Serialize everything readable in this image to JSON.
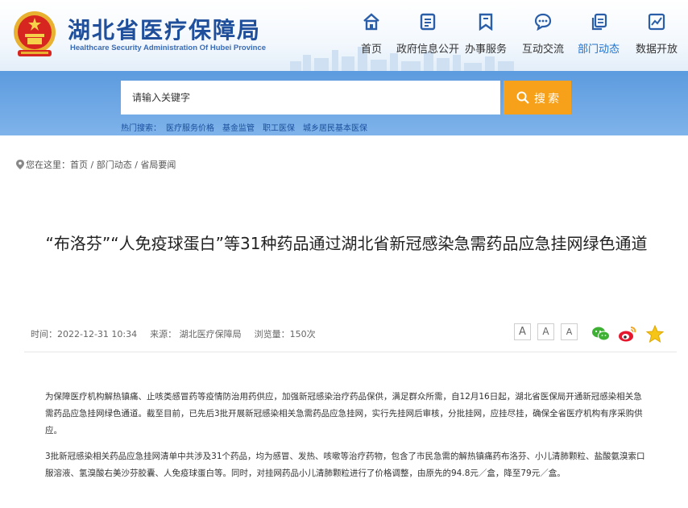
{
  "header": {
    "title": "湖北省医疗保障局",
    "subtitle": "Healthcare Security Administration Of Hubei Province"
  },
  "nav": [
    {
      "label": "首页",
      "icon": "home-icon"
    },
    {
      "label": "政府信息公开",
      "icon": "document-icon"
    },
    {
      "label": "办事服务",
      "icon": "bookmark-icon"
    },
    {
      "label": "互动交流",
      "icon": "chat-icon"
    },
    {
      "label": "部门动态",
      "icon": "copy-icon",
      "active": true
    },
    {
      "label": "数据开放",
      "icon": "chart-icon"
    }
  ],
  "search": {
    "placeholder": "请输入关键字",
    "button_label": "搜索",
    "hot_label": "热门搜索：",
    "hot_items": [
      "医疗服务价格",
      "基金监管",
      "职工医保",
      "城乡居民基本医保"
    ]
  },
  "breadcrumb": {
    "prefix": "您在这里：",
    "items": [
      "首页",
      "部门动态",
      "省局要闻"
    ],
    "separator": " / "
  },
  "article": {
    "title": "“布洛芬”“人免疫球蛋白”等31种药品通过湖北省新冠感染急需药品应急挂网绿色通道",
    "time": "时间：2022-12-31 10:34",
    "source": "来源：  湖北医疗保障局",
    "views": "浏览量：150次",
    "font_sizes": [
      "A",
      "A",
      "A"
    ],
    "share_icons": [
      "wechat-icon",
      "weibo-icon",
      "favorite-star-icon"
    ],
    "paragraphs": [
      "为保障医疗机构解热镇痛、止咳类感冒药等疫情防治用药供应，加强新冠感染治疗药品保供，满足群众所需，自12月16日起，湖北省医保局开通新冠感染相关急需药品应急挂网绿色通道。截至目前，已先后3批开展新冠感染相关急需药品应急挂网，实行先挂网后审核，分批挂网，应挂尽挂，确保全省医疗机构有序采购供应。",
      "3批新冠感染相关药品应急挂网清单中共涉及31个药品，均为感冒、发热、咳嗽等治疗药物，包含了市民急需的解热镇痛药布洛芬、小儿清肺颗粒、盐酸氨溴索口服溶液、氢溴酸右美沙芬胶囊、人免疫球蛋白等。同时，对挂网药品小儿清肺颗粒进行了价格调整，由原先的94.8元／盒，降至79元／盒。"
    ]
  },
  "colors": {
    "brand_blue": "#1f4f9b",
    "banner_blue": "#6fa8e6",
    "search_orange": "#f7a019",
    "nav_active": "#1e73d0"
  }
}
